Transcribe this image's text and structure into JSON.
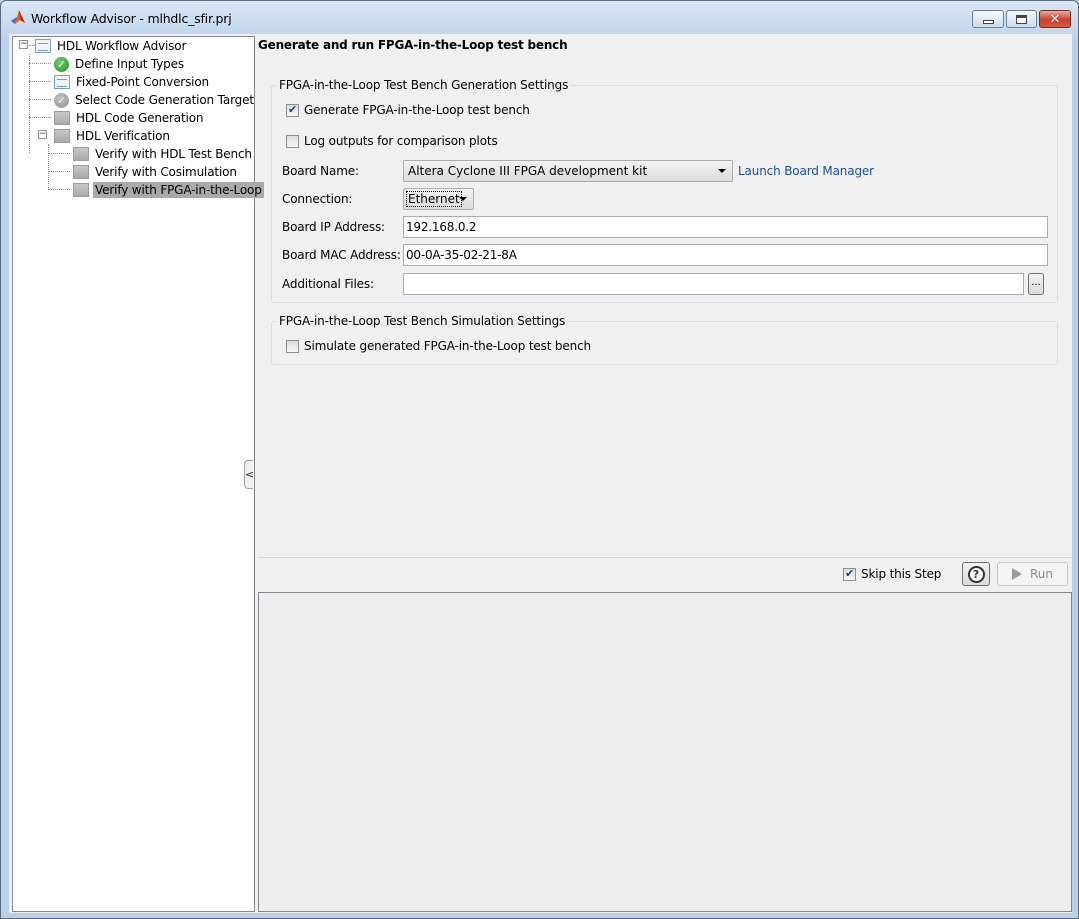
{
  "window": {
    "title": "Workflow Advisor - mlhdlc_sfir.prj",
    "controls": {
      "minimize": "minimize",
      "maximize": "maximize",
      "close": "close"
    }
  },
  "tree": {
    "items": [
      {
        "label": "HDL Workflow Advisor",
        "icon": "list-icon",
        "expanded": true,
        "level": 0
      },
      {
        "label": "Define Input Types",
        "icon": "green-check-icon",
        "level": 1
      },
      {
        "label": "Fixed-Point Conversion",
        "icon": "list-icon",
        "level": 1
      },
      {
        "label": "Select Code Generation Target",
        "icon": "gray-check-icon",
        "level": 1
      },
      {
        "label": "HDL Code Generation",
        "icon": "gray-task-icon",
        "level": 1
      },
      {
        "label": "HDL Verification",
        "icon": "gray-task-icon",
        "expanded": true,
        "level": 1
      },
      {
        "label": "Verify with HDL Test Bench",
        "icon": "gray-task-icon",
        "level": 2
      },
      {
        "label": "Verify with Cosimulation",
        "icon": "gray-task-icon",
        "level": 2
      },
      {
        "label": "Verify with FPGA-in-the-Loop",
        "icon": "gray-task-icon",
        "level": 2,
        "selected": true
      }
    ]
  },
  "main": {
    "title": "Generate and run FPGA-in-the-Loop test bench",
    "generation_group": {
      "legend": "FPGA-in-the-Loop Test Bench Generation Settings",
      "generate_tb": {
        "label": "Generate FPGA-in-the-Loop test bench",
        "checked": true
      },
      "log_outputs": {
        "label": "Log outputs for comparison plots",
        "checked": false
      },
      "board_name": {
        "label": "Board Name:",
        "value": "Altera Cyclone III FPGA development kit"
      },
      "launch_board_manager": "Launch Board Manager",
      "connection": {
        "label": "Connection:",
        "value": "Ethernet"
      },
      "board_ip": {
        "label": "Board IP Address:",
        "value": "192.168.0.2"
      },
      "board_mac": {
        "label": "Board MAC Address:",
        "value": "00-0A-35-02-21-8A"
      },
      "additional_files": {
        "label": "Additional Files:",
        "value": "",
        "browse": "..."
      }
    },
    "simulation_group": {
      "legend": "FPGA-in-the-Loop Test Bench Simulation Settings",
      "simulate_tb": {
        "label": "Simulate generated FPGA-in-the-Loop test bench",
        "checked": false
      }
    },
    "footer": {
      "skip_step": {
        "label": "Skip this Step",
        "checked": true
      },
      "help": "?",
      "run": "Run"
    },
    "splitter_glyph": "<"
  }
}
